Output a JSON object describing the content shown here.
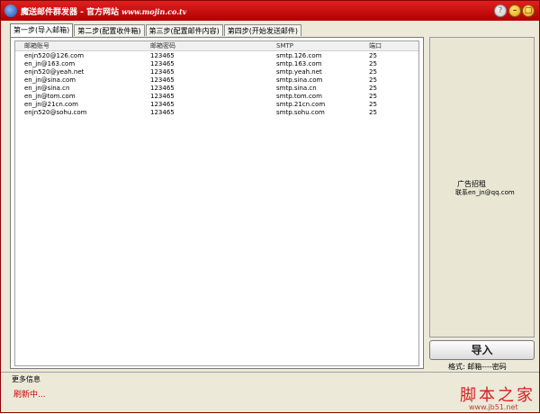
{
  "window": {
    "title": "魔送邮件群发器 - 官方网站",
    "title_url": "www.mojin.co.tv",
    "help_symbol": "?",
    "min_symbol": "–",
    "max_symbol": "□"
  },
  "tabs": [
    {
      "label": "第一步(导入邮箱)",
      "active": true
    },
    {
      "label": "第二步(配置收件箱)",
      "active": false
    },
    {
      "label": "第三步(配置邮件内容)",
      "active": false
    },
    {
      "label": "第四步(开始发送邮件)",
      "active": false
    }
  ],
  "table": {
    "columns": [
      "邮箱账号",
      "邮箱密码",
      "SMTP",
      "端口"
    ],
    "rows": [
      [
        "enjn520@126.com",
        "123465",
        "smtp.126.com",
        "25"
      ],
      [
        "en_jn@163.com",
        "123465",
        "smtp.163.com",
        "25"
      ],
      [
        "enjn520@yeah.net",
        "123465",
        "smtp.yeah.net",
        "25"
      ],
      [
        "en_jn@sina.com",
        "123465",
        "smtp.sina.com",
        "25"
      ],
      [
        "en_jn@sina.cn",
        "123465",
        "smtp.sina.cn",
        "25"
      ],
      [
        "en_jn@tom.com",
        "123465",
        "smtp.tom.com",
        "25"
      ],
      [
        "en_jn@21cn.com",
        "123465",
        "smtp.21cn.com",
        "25"
      ],
      [
        "enjn520@sohu.com",
        "123465",
        "smtp.sohu.com",
        "25"
      ]
    ]
  },
  "side": {
    "ad_title": "广告招租",
    "ad_contact": "联系en_jn@qq.com",
    "import_button": "导入",
    "format_label": "格式: 邮箱----密码"
  },
  "footer": {
    "more_info_label": "更多信息",
    "status": "刷新中..."
  },
  "watermark": {
    "text": "脚本之家",
    "url": "www.jb51.net"
  },
  "colors": {
    "titlebar": "#c00000",
    "status": "#d00000"
  }
}
